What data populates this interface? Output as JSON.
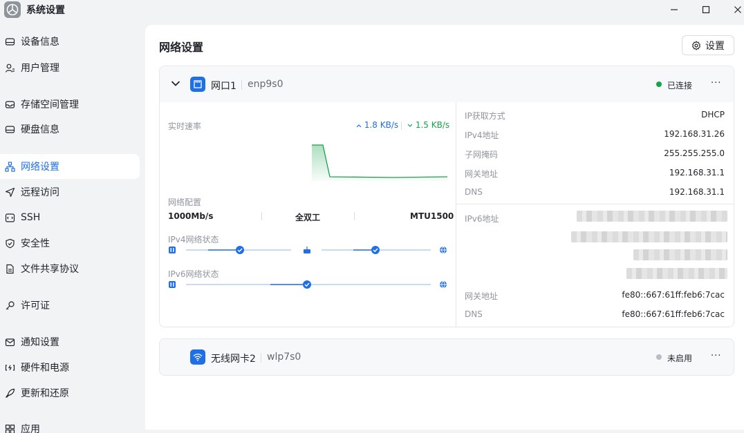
{
  "window": {
    "title": "系统设置"
  },
  "sidebar": {
    "items": [
      {
        "label": "设备信息",
        "icon": "device-icon"
      },
      {
        "label": "用户管理",
        "icon": "user-icon"
      },
      {
        "label": "存储空间管理",
        "icon": "storage-icon"
      },
      {
        "label": "硬盘信息",
        "icon": "disk-icon"
      },
      {
        "label": "网络设置",
        "icon": "network-icon",
        "active": true
      },
      {
        "label": "远程访问",
        "icon": "send-icon"
      },
      {
        "label": "SSH",
        "icon": "ssh-icon"
      },
      {
        "label": "安全性",
        "icon": "shield-icon"
      },
      {
        "label": "文件共享协议",
        "icon": "file-icon"
      },
      {
        "label": "许可证",
        "icon": "key-icon"
      },
      {
        "label": "通知设置",
        "icon": "mail-icon"
      },
      {
        "label": "硬件和电源",
        "icon": "power-icon"
      },
      {
        "label": "更新和还原",
        "icon": "rocket-icon"
      },
      {
        "label": "应用",
        "icon": "apps-icon"
      }
    ]
  },
  "main": {
    "title": "网络设置",
    "settings_button": "设置"
  },
  "port1": {
    "name": "网口1",
    "device": "enp9s0",
    "status": "已连接",
    "status_color": "#16a34a",
    "more": "···",
    "speed_label": "实时速率",
    "upload": "1.8 KB/s",
    "download": "1.5 KB/s",
    "config_label": "网络配置",
    "link_speed": "1000Mb/s",
    "duplex": "全双工",
    "mtu": "MTU1500",
    "ipv4_status_label": "IPv4网络状态",
    "ipv6_status_label": "IPv6网络状态",
    "ipv4": {
      "method_label": "IP获取方式",
      "method": "DHCP",
      "addr_label": "IPv4地址",
      "addr": "192.168.31.26",
      "mask_label": "子网掩码",
      "mask": "255.255.255.0",
      "gateway_label": "网关地址",
      "gateway": "192.168.31.1",
      "dns_label": "DNS",
      "dns": "192.168.31.1"
    },
    "ipv6": {
      "addr_label": "IPv6地址",
      "gateway_label": "网关地址",
      "gateway": "fe80::667:61ff:feb6:7cac",
      "dns_label": "DNS",
      "dns": "fe80::667:61ff:feb6:7cac"
    }
  },
  "port2": {
    "name": "无线网卡2",
    "device": "wlp7s0",
    "status": "未启用",
    "status_color": "#b8bcc3",
    "more": "···"
  },
  "colors": {
    "accent": "#1f6fe5",
    "download": "#16a34a"
  }
}
